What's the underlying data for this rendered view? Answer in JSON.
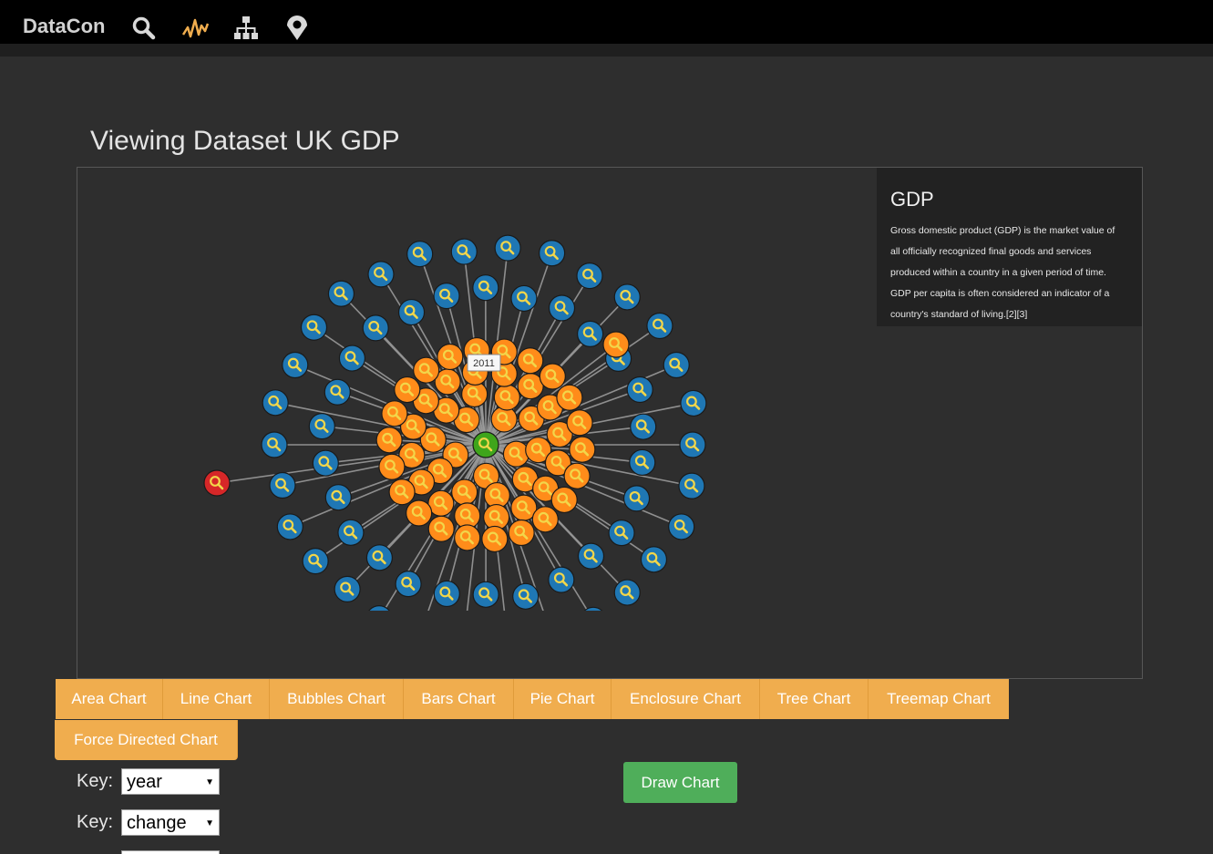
{
  "nav": {
    "brand": "DataCon",
    "icons": [
      "search-icon",
      "activity-icon",
      "hierarchy-icon",
      "map-pin-icon"
    ]
  },
  "page": {
    "title": "Viewing Dataset UK GDP"
  },
  "info": {
    "heading": "GDP",
    "lines": [
      "Gross domestic product (GDP) is the market value of",
      "all officially recognized final goods and services",
      "produced within a country in a given period of time.",
      "GDP per capita is often considered an indicator of a",
      "country's standard of living.[2][3]"
    ]
  },
  "graph": {
    "tooltip": "2011",
    "colors": {
      "center": "#3fa51b",
      "inner": "#ff8c1a",
      "outer": "#1f77b4",
      "highlight": "#d62728",
      "link": "#9a9a9a",
      "glyph": "#f2d64a"
    }
  },
  "tabs": {
    "area": "Area Chart",
    "line": "Line Chart",
    "bubbles": "Bubbles Chart",
    "bars": "Bars Chart",
    "pie": "Pie Chart",
    "enclosure": "Enclosure Chart",
    "tree": "Tree Chart",
    "treemap": "Treemap Chart",
    "force": "Force Directed Chart"
  },
  "controls": {
    "draw_button": "Draw Chart",
    "key_label": "Key:",
    "key1_value": "year",
    "key2_value": "change"
  }
}
